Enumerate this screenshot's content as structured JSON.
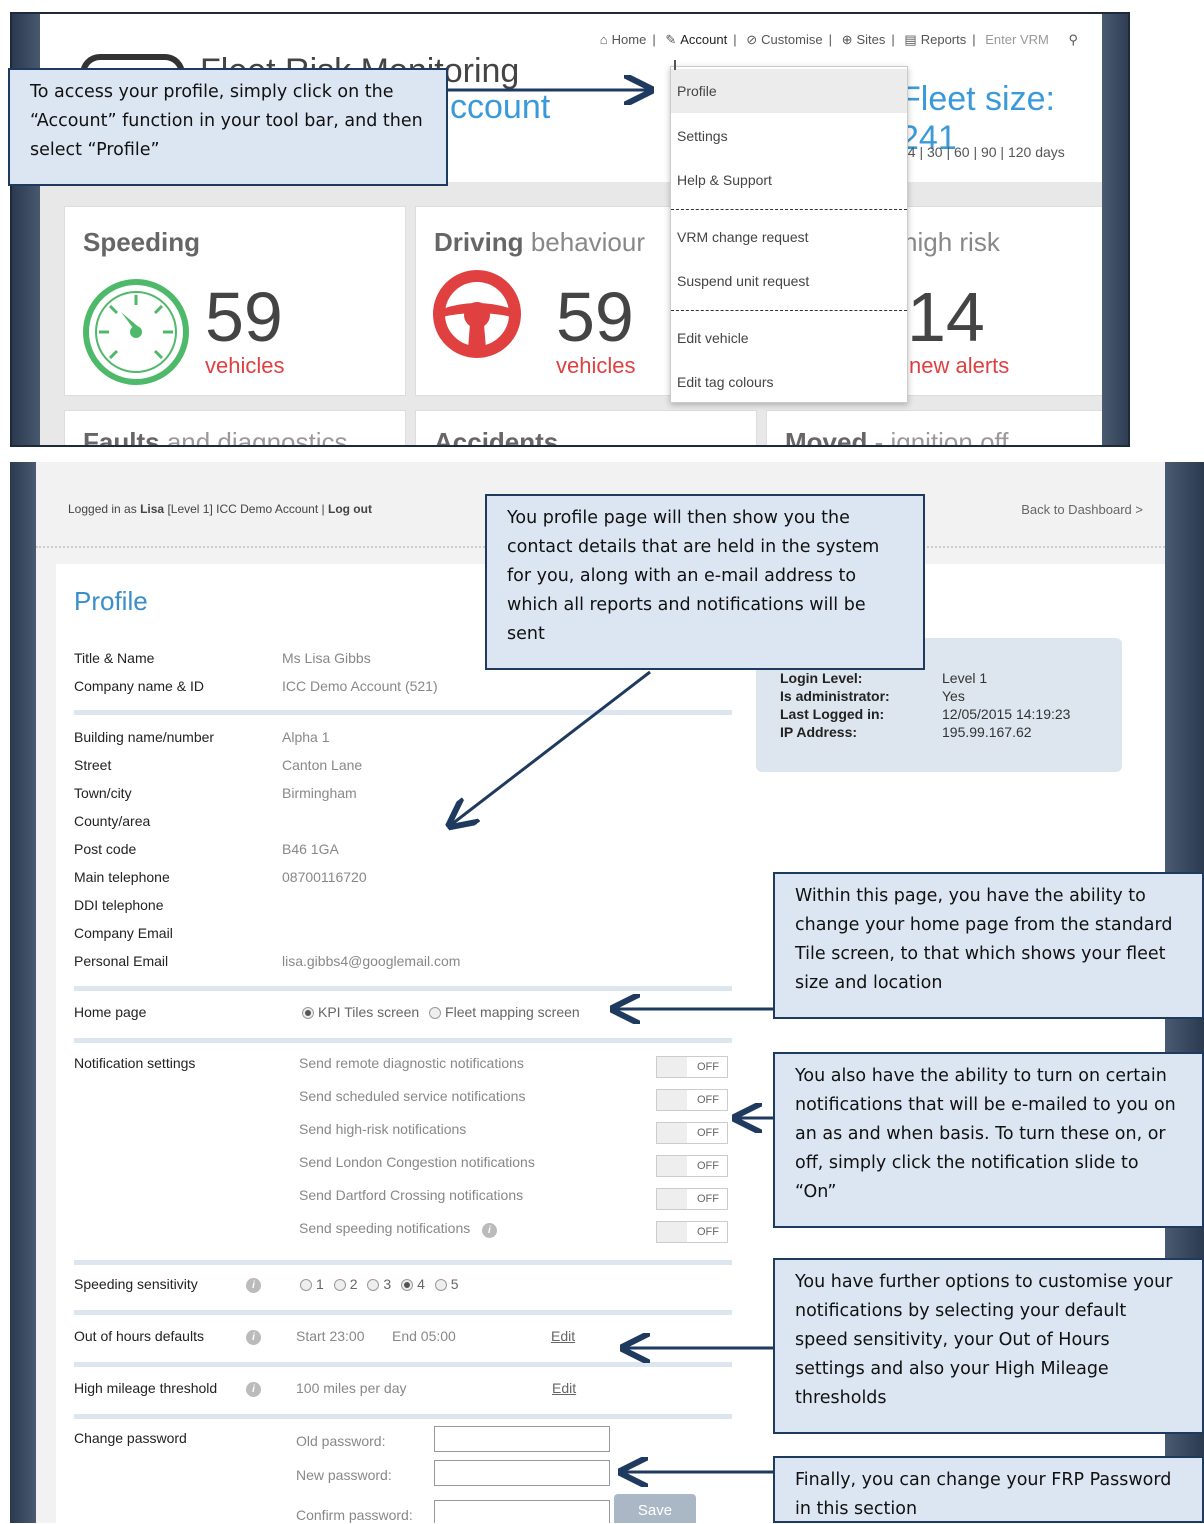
{
  "panel1": {
    "nav": [
      "Home",
      "Account",
      "Customise",
      "Sites",
      "Reports",
      "Enter VRM"
    ],
    "app_title": "Fleet Risk Monitoring",
    "account_sub": "ccount",
    "fleet_size": "Fleet size: 241",
    "days": "14  |  30  |  60  |  90  |  120  days",
    "dropdown": [
      "Profile",
      "Settings",
      "Help & Support",
      "VRM change request",
      "Suspend unit request",
      "Edit vehicle",
      "Edit tag colours"
    ],
    "tiles": {
      "speeding": {
        "title": "Speeding",
        "value": "59",
        "unit": "vehicles"
      },
      "driving": {
        "title": "Driving",
        "title_light": "behaviour",
        "value": "59",
        "unit": "vehicles"
      },
      "highrisk": {
        "title_light": "high risk",
        "value": "14",
        "unit": "new alerts"
      },
      "faults": {
        "title": "Faults",
        "title_light": "and diagnostics"
      },
      "accidents": {
        "title": "Accidents"
      },
      "moved": {
        "title": "Moved",
        "title_light": "- ignition off"
      }
    },
    "callout": "To access your profile, simply click on the “Account” function in your tool bar, and then select “Profile”"
  },
  "panel2": {
    "login": {
      "prefix": "Logged in as",
      "user": "Lisa",
      "rest": "[Level 1]  ICC Demo Account  |",
      "logout": "Log out"
    },
    "back": "Back to Dashboard >",
    "title": "Profile",
    "fields": [
      {
        "label": "Title & Name",
        "value": "Ms Lisa Gibbs"
      },
      {
        "label": "Company name & ID",
        "value": "ICC Demo Account (521)"
      },
      {
        "label": "Building name/number",
        "value": "Alpha 1"
      },
      {
        "label": "Street",
        "value": "Canton Lane"
      },
      {
        "label": "Town/city",
        "value": "Birmingham"
      },
      {
        "label": "County/area",
        "value": ""
      },
      {
        "label": "Post code",
        "value": "B46 1GA"
      },
      {
        "label": "Main telephone",
        "value": "08700116720"
      },
      {
        "label": "DDI telephone",
        "value": ""
      },
      {
        "label": "Company Email",
        "value": ""
      },
      {
        "label": "Personal Email",
        "value": "lisa.gibbs4@googlemail.com"
      }
    ],
    "info": [
      {
        "k": "Login Level:",
        "v": "Level 1"
      },
      {
        "k": "Is administrator:",
        "v": "Yes"
      },
      {
        "k": "Last Logged in:",
        "v": "12/05/2015 14:19:23"
      },
      {
        "k": "IP Address:",
        "v": "195.99.167.62"
      }
    ],
    "homepage": {
      "label": "Home page",
      "opt1": "KPI Tiles screen",
      "opt2": "Fleet mapping screen"
    },
    "notifications": {
      "label": "Notification settings",
      "items": [
        "Send remote diagnostic notifications",
        "Send scheduled service notifications",
        "Send high-risk notifications",
        "Send London Congestion notifications",
        "Send Dartford Crossing notifications",
        "Send speeding notifications"
      ],
      "state": "OFF"
    },
    "sensitivity": {
      "label": "Speeding sensitivity",
      "options": [
        "1",
        "2",
        "3",
        "4",
        "5"
      ],
      "selected": "4"
    },
    "ooh": {
      "label": "Out of hours defaults",
      "start": "Start 23:00",
      "end": "End 05:00",
      "edit": "Edit"
    },
    "mileage": {
      "label": "High mileage threshold",
      "value": "100 miles per day",
      "edit": "Edit"
    },
    "password": {
      "label": "Change password",
      "old": "Old password:",
      "new": "New password:",
      "confirm": "Confirm password:",
      "save": "Save"
    },
    "callouts": {
      "profile": "You profile page will then show you the contact details that are held in the system for you, along with an e-mail address to which all reports and notifications will be sent",
      "homepage": "Within this page, you have the ability to change your home page from the standard Tile screen, to that which shows your fleet size and location",
      "notifications": "You also have the ability to turn on certain notifications that will be e-mailed to you on an as and when basis. To turn these on, or off, simply click the notification slide to “On”",
      "options": "You have further options to customise your notifications by selecting your default speed sensitivity, your Out of Hours settings and also your High Mileage thresholds",
      "password": "Finally, you can change your FRP Password in this section"
    }
  },
  "colors": {
    "accent": "#3a8ec9",
    "alert": "#e04040",
    "callout_bg": "#dce6f2",
    "callout_border": "#1f3a5f"
  }
}
